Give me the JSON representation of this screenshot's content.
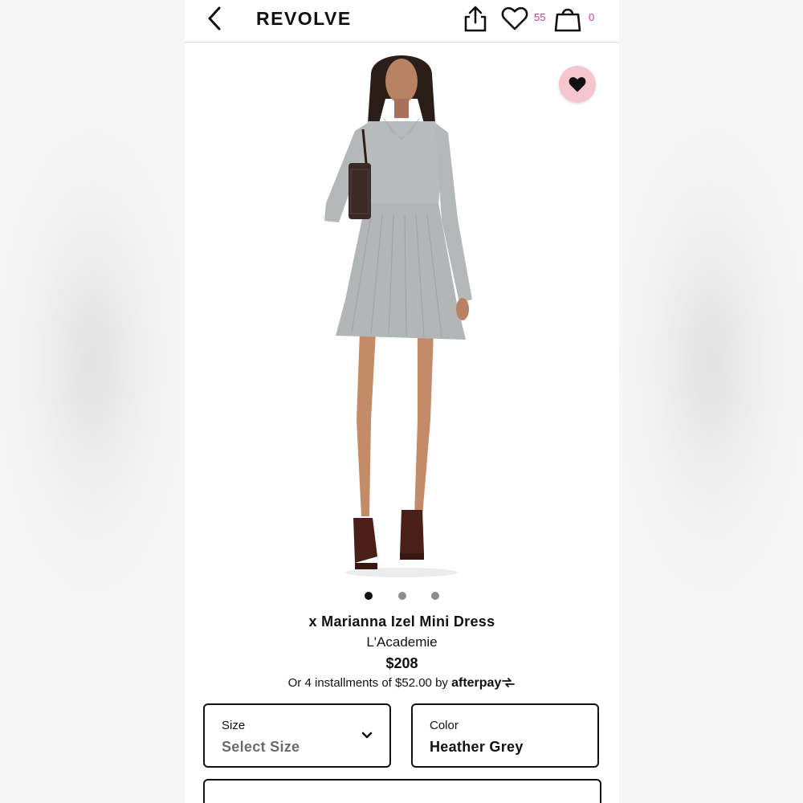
{
  "header": {
    "logo": "REVOLVE",
    "wishlist_count": "55",
    "bag_count": "0"
  },
  "icons": {
    "back": "back-chevron-icon",
    "share": "share-icon",
    "wishlist": "heart-outline-icon",
    "bag": "shopping-bag-icon",
    "favorite": "heart-filled-icon",
    "dropdown": "chevron-down-icon"
  },
  "carousel": {
    "total": 3,
    "active_index": 0
  },
  "product": {
    "title": "x Marianna Izel Mini Dress",
    "brand": "L'Academie",
    "price": "$208",
    "installments_text": "Or 4 installments of $52.00 by",
    "afterpay_label": "afterpay"
  },
  "size_select": {
    "label": "Size",
    "value": "Select Size"
  },
  "color_select": {
    "label": "Color",
    "value": "Heather Grey"
  },
  "colors": {
    "accent_count": "#c2408d",
    "favorite_bg": "#f6c6d0",
    "dress": "#b9bcbd",
    "placeholder_text": "#6b6b6b"
  }
}
